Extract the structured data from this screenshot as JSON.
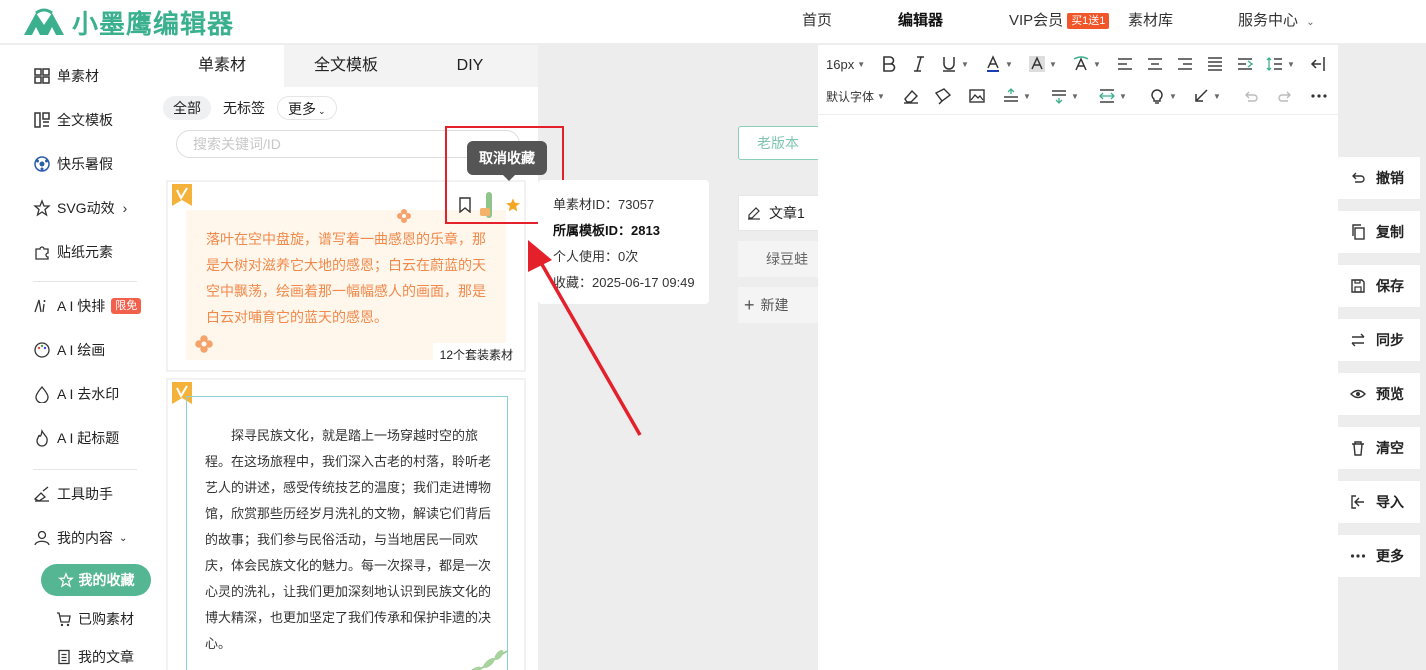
{
  "header": {
    "logo_text": "小墨鹰编辑器",
    "nav": {
      "home": "首页",
      "editor": "编辑器",
      "vip": "VIP会员",
      "vip_badge": "买1送1",
      "library": "素材库",
      "service": "服务中心"
    }
  },
  "sidebar": {
    "items": [
      {
        "label": "单素材",
        "icon": "grid-icon"
      },
      {
        "label": "全文模板",
        "icon": "template-icon"
      },
      {
        "label": "快乐暑假",
        "icon": "ball-icon"
      },
      {
        "label": "SVG动效",
        "icon": "star-outline-icon"
      },
      {
        "label": "贴纸元素",
        "icon": "puzzle-icon"
      },
      {
        "label": "A I 快排",
        "icon": "ai-icon",
        "badge": "限免"
      },
      {
        "label": "A I 绘画",
        "icon": "palette-icon"
      },
      {
        "label": "A I 去水印",
        "icon": "drop-icon"
      },
      {
        "label": "A I 起标题",
        "icon": "fire-icon"
      },
      {
        "label": "工具助手",
        "icon": "tools-icon"
      },
      {
        "label": "我的内容",
        "icon": "user-icon"
      }
    ],
    "favorites": "我的收藏",
    "purchased": "已购素材",
    "my_articles": "我的文章"
  },
  "panel": {
    "tabs": [
      "单素材",
      "全文模板",
      "DIY"
    ],
    "filters": [
      "全部",
      "无标签",
      "更多"
    ],
    "search_placeholder": "搜索关键词/ID",
    "card1": {
      "text": "落叶在空中盘旋，谱写着一曲感恩的乐章，那是大树对滋养它大地的感恩；白云在蔚蓝的天空中飘荡，绘画着那一幅幅感人的画面，那是白云对哺育它的蓝天的感恩。",
      "count": "12个套装素材"
    },
    "card2": {
      "text": "探寻民族文化，就是踏上一场穿越时空的旅程。在这场旅程中，我们深入古老的村落，聆听老艺人的讲述，感受传统技艺的温度；我们走进博物馆，欣赏那些历经岁月洗礼的文物，解读它们背后的故事；我们参与民俗活动，与当地居民一同欢庆，体会民族文化的魅力。每一次探寻，都是一次心灵的洗礼，让我们更加深刻地认识到民族文化的博大精深，也更加坚定了我们传承和保护非遗的决心。"
    }
  },
  "tooltip": "取消收藏",
  "info": {
    "material_id_label": "单素材ID：",
    "material_id": "73057",
    "template_id_label": "所属模板ID：",
    "template_id": "2813",
    "usage": "个人使用：0次",
    "collected": "收藏：2025-06-17 09:49"
  },
  "middle": {
    "old_version": "老版本",
    "doc1": "文章1",
    "doc2": "绿豆蛙",
    "new": "新建"
  },
  "editor": {
    "font_size": "16px",
    "font_family": "默认字体"
  },
  "right_tools": [
    "撤销",
    "复制",
    "保存",
    "同步",
    "预览",
    "清空",
    "导入",
    "更多"
  ],
  "colors": {
    "brand": "#3bb08f",
    "active_pill": "#54b693",
    "highlight_box": "#e4202a",
    "star": "#f5a623"
  }
}
